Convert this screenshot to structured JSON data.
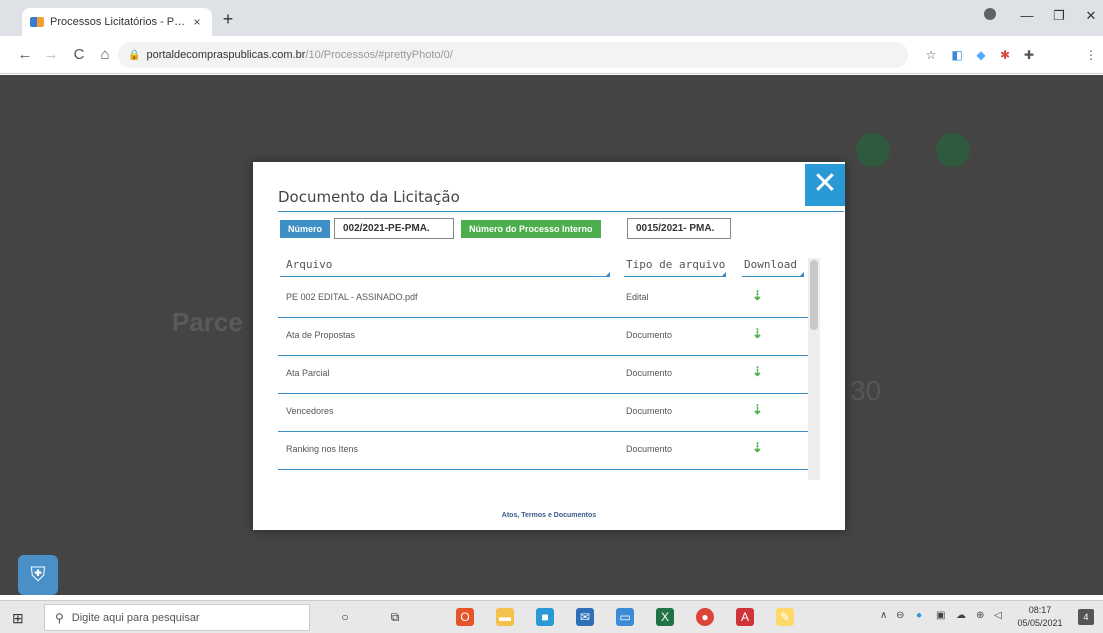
{
  "browser": {
    "tab_title": "Processos Licitatórios - Portal de Compras Públicas",
    "tab_close": "×",
    "new_tab": "+",
    "url_host": "portaldecompraspublicas.com.br",
    "url_path": "/10/Processos/#prettyPhoto/0/",
    "nav_back": "←",
    "nav_forward": "→",
    "nav_reload": "C",
    "nav_home": "⌂",
    "menu": "⋮",
    "minimize": "—",
    "maximize": "❐",
    "close": "✕"
  },
  "background_page": {
    "heading": "Parce",
    "number": "30"
  },
  "modal": {
    "title": "Documento da Licitação",
    "close_label": "✕",
    "numero_label": "Número",
    "numero_value": "002/2021-PE-PMA.",
    "processo_label": "Número do Processo Interno",
    "processo_value": "0015/2021- PMA.",
    "headers": {
      "file": "Arquivo",
      "type": "Tipo de arquivo",
      "download": "Download"
    },
    "rows": [
      {
        "file": "PE 002 EDITAL - ASSINADO.pdf",
        "type": "Edital",
        "icon": "download-arrow-icon"
      },
      {
        "file": "Ata de Propostas",
        "type": "Documento",
        "icon": "download-arrow-icon"
      },
      {
        "file": "Ata Parcial",
        "type": "Documento",
        "icon": "download-arrow-icon"
      },
      {
        "file": "Vencedores",
        "type": "Documento",
        "icon": "download-arrow-icon"
      },
      {
        "file": "Ranking nos Itens",
        "type": "Documento",
        "icon": "download-arrow-icon"
      }
    ],
    "footer_link": "Atos, Termos e Documentos"
  },
  "taskbar": {
    "search_placeholder": "Digite aqui para pesquisar",
    "time": "08:17",
    "date": "05/05/2021",
    "notifications": "4"
  },
  "colors": {
    "accent_blue": "#3d8fc6",
    "accent_green": "#4cae4c",
    "close_blue": "#2a9ad6",
    "overlay": "#444444"
  }
}
